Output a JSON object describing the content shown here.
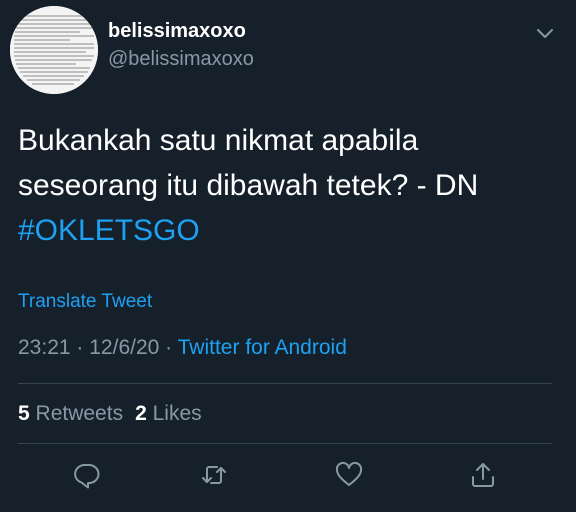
{
  "profile": {
    "display_name": "belissimaxoxo",
    "handle": "@belissimaxoxo",
    "avatar_icon": "text-collage-avatar"
  },
  "tweet": {
    "line1": "Bukankah satu nikmat apabila",
    "line2": "seseorang itu dibawah tetek? - DN",
    "hashtag": "#OKLETSGO"
  },
  "translate_label": "Translate Tweet",
  "meta": {
    "time": "23:21",
    "separator": "·",
    "date": "12/6/20",
    "source": "Twitter for Android"
  },
  "stats": {
    "retweets_count": "5",
    "retweets_label": "Retweets",
    "likes_count": "2",
    "likes_label": "Likes"
  },
  "actions": [
    "reply-icon",
    "retweet-icon",
    "like-icon",
    "share-icon"
  ],
  "colors": {
    "background": "#15202b",
    "accent": "#1da1f2",
    "muted": "#8899a6",
    "divider": "#38444d"
  }
}
